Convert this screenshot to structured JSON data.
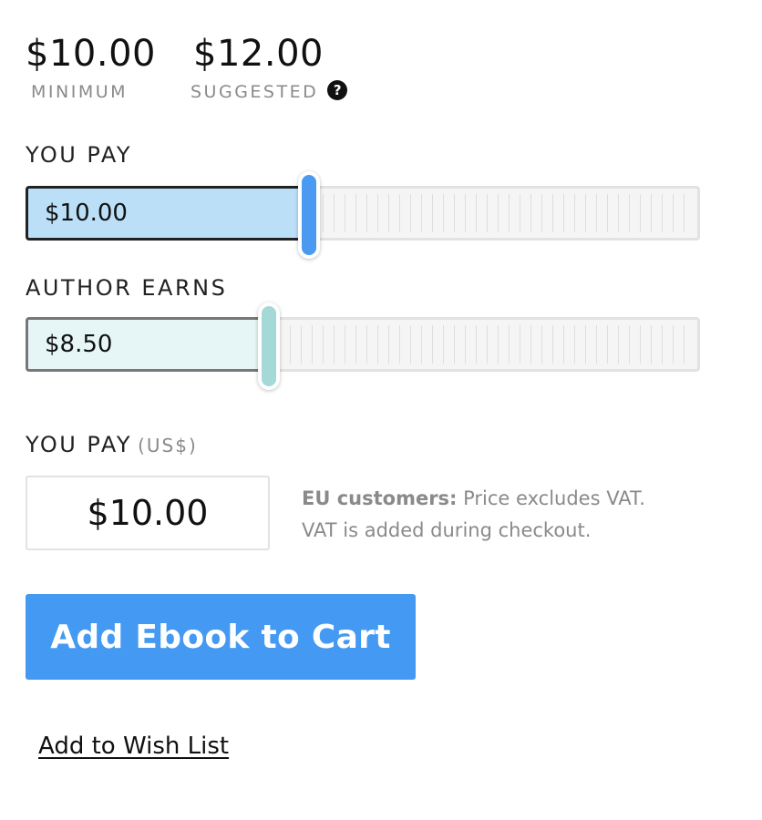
{
  "prices": {
    "minimum": {
      "amount": "$10.00",
      "caption": "MINIMUM"
    },
    "suggested": {
      "amount": "$12.00",
      "caption": "SUGGESTED",
      "help_icon": "?"
    }
  },
  "you_pay_slider": {
    "label": "YOU PAY",
    "value_text": "$10.00",
    "level": 0.42,
    "colors": {
      "fill": "#bcdff8",
      "handle": "#4a9af2"
    }
  },
  "author_earns_slider": {
    "label": "AUTHOR EARNS",
    "value_text": "$8.50",
    "level": 0.36,
    "colors": {
      "fill": "#e6f6f6",
      "handle": "#a4d9d8"
    }
  },
  "you_pay_input": {
    "label": "YOU PAY",
    "currency": "(US$)",
    "value": "$10.00"
  },
  "vat_note": {
    "bold": "EU customers:",
    "line1_rest": " Price excludes VAT.",
    "line2": "VAT is added during checkout."
  },
  "actions": {
    "add_to_cart": "Add Ebook to Cart",
    "add_to_wishlist": "Add to Wish List"
  },
  "colors": {
    "accent": "#4499f2",
    "muted_text": "#8a8a8a"
  }
}
